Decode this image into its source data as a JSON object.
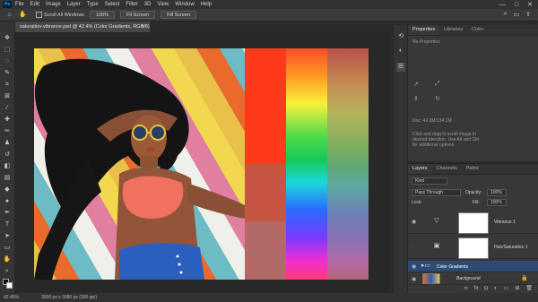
{
  "app": {
    "logo": "Ps"
  },
  "menu": [
    "File",
    "Edit",
    "Image",
    "Layer",
    "Type",
    "Select",
    "Filter",
    "3D",
    "View",
    "Window",
    "Help"
  ],
  "window_controls": [
    "—",
    "□",
    "✕"
  ],
  "options": {
    "scroll_all_label": "Scroll All Windows",
    "zoom_value": "100%",
    "fit_screen": "Fit Screen",
    "fill_screen": "Fill Screen"
  },
  "document_tab": {
    "title": "saturation-vibrance.psd @ 42.4% (Color Gradients, RGB/8) *"
  },
  "status": {
    "zoom": "42.45%",
    "doc_info": "3030 px x 3080 px (300 ppi)"
  },
  "properties": {
    "tabs": [
      "Properties",
      "Libraries",
      "Color"
    ],
    "no_properties": "No Properties",
    "doc_label": "Doc: 42.0M/134.1M",
    "hint": "Click and drag to scroll image in desired direction. Use Alt and Ctrl for additional options."
  },
  "layers": {
    "tabs": [
      "Layers",
      "Channels",
      "Paths"
    ],
    "kind_filter": "Kind",
    "blend_mode": "Pass Through",
    "opacity_label": "Opacity:",
    "opacity_value": "100%",
    "lock_label": "Lock:",
    "fill_label": "Fill:",
    "fill_value": "100%",
    "items": [
      {
        "name": "Vibrance 1"
      },
      {
        "name": "Hue/Saturation 1"
      },
      {
        "name": "Color Gradients"
      },
      {
        "name": "Background"
      }
    ]
  },
  "colors": {
    "accent": "#31a8ff",
    "selected_layer": "#2d4a73"
  }
}
